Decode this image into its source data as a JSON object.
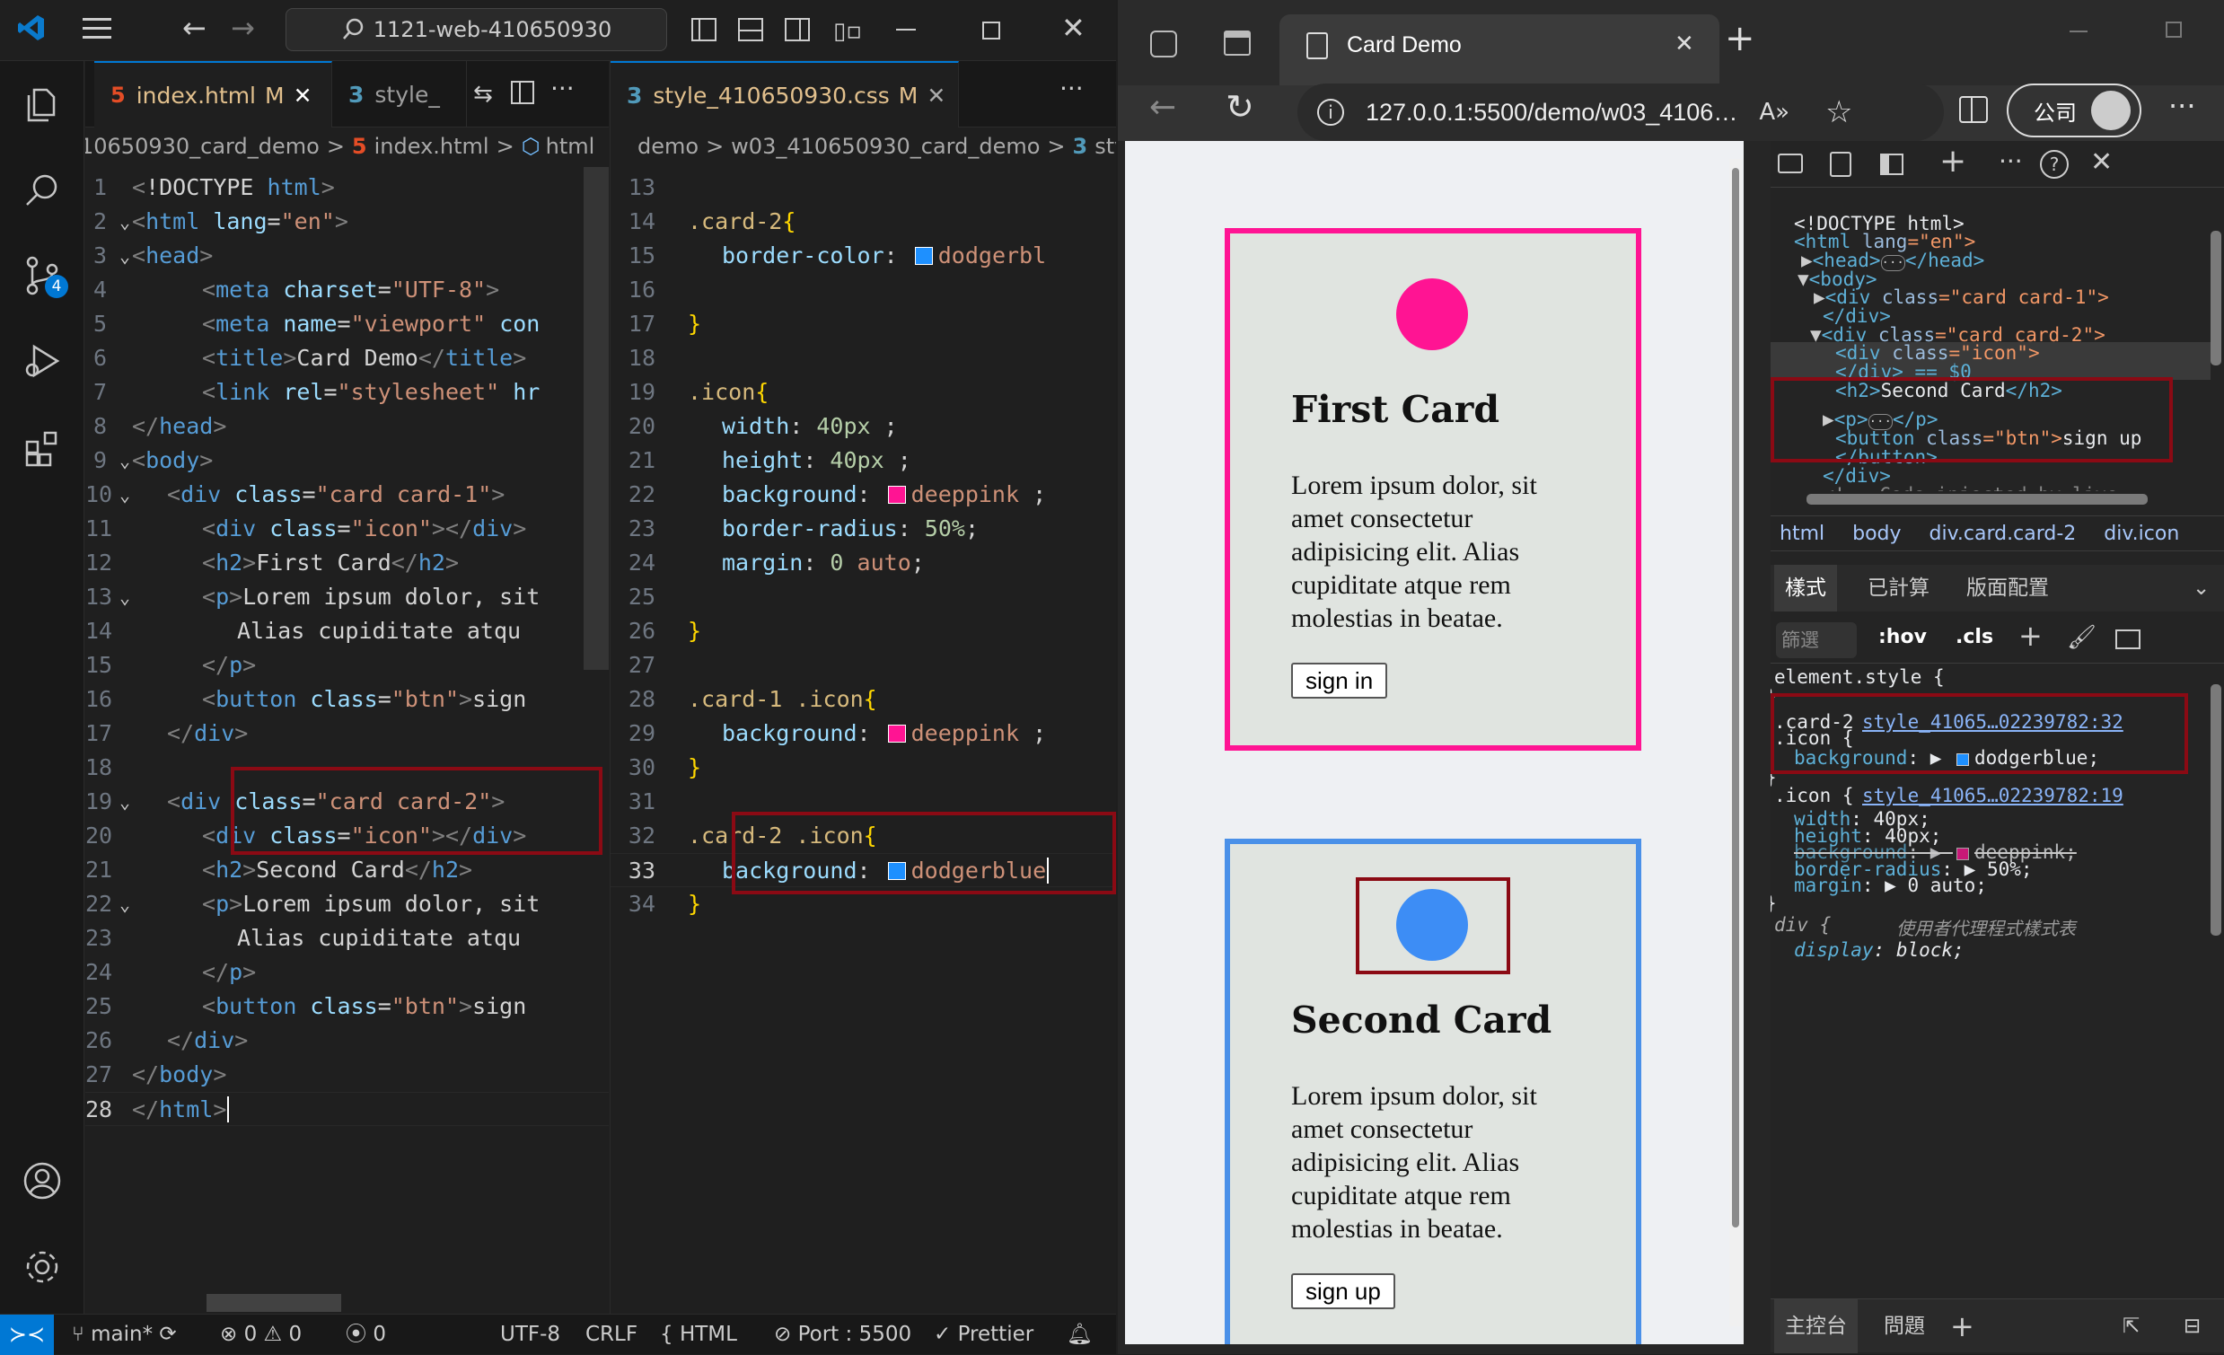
{
  "vscode": {
    "search_text": "1121-web-410650930",
    "activity_badge": "4",
    "left_tabs": [
      {
        "label": "index.html",
        "modified": "M"
      },
      {
        "label": "style_"
      }
    ],
    "right_tabs": [
      {
        "label": "style_410650930.css",
        "modified": "M"
      }
    ],
    "left_crumb": [
      "10650930_card_demo",
      ">",
      "index.html",
      ">",
      "html"
    ],
    "right_crumb": [
      "demo",
      ">",
      "w03_410650930_card_demo",
      ">",
      "sty"
    ],
    "html_lines": [
      {
        "n": "1",
        "tokens": [
          [
            "p",
            "<"
          ],
          [
            "w",
            "!DOCTYPE "
          ],
          [
            "t",
            "html"
          ],
          [
            "p",
            ">"
          ]
        ],
        "indent": 0
      },
      {
        "n": "2",
        "fold": true,
        "tokens": [
          [
            "p",
            "<"
          ],
          [
            "t",
            "html "
          ],
          [
            "a",
            "lang"
          ],
          [
            "w",
            "="
          ],
          [
            "s",
            "\"en\""
          ],
          [
            "p",
            ">"
          ]
        ],
        "indent": 0
      },
      {
        "n": "3",
        "fold": true,
        "tokens": [
          [
            "p",
            "<"
          ],
          [
            "t",
            "head"
          ],
          [
            "p",
            ">"
          ]
        ],
        "indent": 0
      },
      {
        "n": "4",
        "tokens": [
          [
            "p",
            "<"
          ],
          [
            "t",
            "meta "
          ],
          [
            "a",
            "charset"
          ],
          [
            "w",
            "="
          ],
          [
            "s",
            "\"UTF-8\""
          ],
          [
            "p",
            ">"
          ]
        ],
        "indent": 2
      },
      {
        "n": "5",
        "tokens": [
          [
            "p",
            "<"
          ],
          [
            "t",
            "meta "
          ],
          [
            "a",
            "name"
          ],
          [
            "w",
            "="
          ],
          [
            "s",
            "\"viewport\""
          ],
          [
            "w",
            " "
          ],
          [
            "a",
            "con"
          ]
        ],
        "indent": 2
      },
      {
        "n": "6",
        "tokens": [
          [
            "p",
            "<"
          ],
          [
            "t",
            "title"
          ],
          [
            "p",
            ">"
          ],
          [
            "w",
            "Card Demo"
          ],
          [
            "p",
            "</"
          ],
          [
            "t",
            "title"
          ],
          [
            "p",
            ">"
          ]
        ],
        "indent": 2
      },
      {
        "n": "7",
        "tokens": [
          [
            "p",
            "<"
          ],
          [
            "t",
            "link "
          ],
          [
            "a",
            "rel"
          ],
          [
            "w",
            "="
          ],
          [
            "s",
            "\"stylesheet\""
          ],
          [
            "w",
            " "
          ],
          [
            "a",
            "hr"
          ]
        ],
        "indent": 2
      },
      {
        "n": "8",
        "tokens": [
          [
            "p",
            "</"
          ],
          [
            "t",
            "head"
          ],
          [
            "p",
            ">"
          ]
        ],
        "indent": 0
      },
      {
        "n": "9",
        "fold": true,
        "tokens": [
          [
            "p",
            "<"
          ],
          [
            "t",
            "body"
          ],
          [
            "p",
            ">"
          ]
        ],
        "indent": 0
      },
      {
        "n": "10",
        "fold": true,
        "tokens": [
          [
            "p",
            "<"
          ],
          [
            "t",
            "div "
          ],
          [
            "a",
            "class"
          ],
          [
            "w",
            "="
          ],
          [
            "s",
            "\"card card-1\""
          ],
          [
            "p",
            ">"
          ]
        ],
        "indent": 1
      },
      {
        "n": "11",
        "tokens": [
          [
            "p",
            "<"
          ],
          [
            "t",
            "div "
          ],
          [
            "a",
            "class"
          ],
          [
            "w",
            "="
          ],
          [
            "s",
            "\"icon\""
          ],
          [
            "p",
            "></"
          ],
          [
            "t",
            "div"
          ],
          [
            "p",
            ">"
          ]
        ],
        "indent": 2
      },
      {
        "n": "12",
        "tokens": [
          [
            "p",
            "<"
          ],
          [
            "t",
            "h2"
          ],
          [
            "p",
            ">"
          ],
          [
            "w",
            "First Card"
          ],
          [
            "p",
            "</"
          ],
          [
            "t",
            "h2"
          ],
          [
            "p",
            ">"
          ]
        ],
        "indent": 2
      },
      {
        "n": "13",
        "fold": true,
        "tokens": [
          [
            "p",
            "<"
          ],
          [
            "t",
            "p"
          ],
          [
            "p",
            ">"
          ],
          [
            "w",
            "Lorem ipsum dolor, sit"
          ]
        ],
        "indent": 2
      },
      {
        "n": "14",
        "tokens": [
          [
            "w",
            "Alias cupiditate atqu"
          ]
        ],
        "indent": 3
      },
      {
        "n": "15",
        "tokens": [
          [
            "p",
            "</"
          ],
          [
            "t",
            "p"
          ],
          [
            "p",
            ">"
          ]
        ],
        "indent": 2
      },
      {
        "n": "16",
        "tokens": [
          [
            "p",
            "<"
          ],
          [
            "t",
            "button "
          ],
          [
            "a",
            "class"
          ],
          [
            "w",
            "="
          ],
          [
            "s",
            "\"btn\""
          ],
          [
            "p",
            ">"
          ],
          [
            "w",
            "sign"
          ]
        ],
        "indent": 2
      },
      {
        "n": "17",
        "tokens": [
          [
            "p",
            "</"
          ],
          [
            "t",
            "div"
          ],
          [
            "p",
            ">"
          ]
        ],
        "indent": 1
      },
      {
        "n": "18",
        "tokens": [],
        "indent": 0
      },
      {
        "n": "19",
        "fold": true,
        "tokens": [
          [
            "p",
            "<"
          ],
          [
            "t",
            "div "
          ],
          [
            "a",
            "class"
          ],
          [
            "w",
            "="
          ],
          [
            "s",
            "\"card card-2\""
          ],
          [
            "p",
            ">"
          ]
        ],
        "indent": 1
      },
      {
        "n": "20",
        "tokens": [
          [
            "p",
            "<"
          ],
          [
            "t",
            "div "
          ],
          [
            "a",
            "class"
          ],
          [
            "w",
            "="
          ],
          [
            "s",
            "\"icon\""
          ],
          [
            "p",
            "></"
          ],
          [
            "t",
            "div"
          ],
          [
            "p",
            ">"
          ]
        ],
        "indent": 2
      },
      {
        "n": "21",
        "tokens": [
          [
            "p",
            "<"
          ],
          [
            "t",
            "h2"
          ],
          [
            "p",
            ">"
          ],
          [
            "w",
            "Second Card"
          ],
          [
            "p",
            "</"
          ],
          [
            "t",
            "h2"
          ],
          [
            "p",
            ">"
          ]
        ],
        "indent": 2
      },
      {
        "n": "22",
        "fold": true,
        "tokens": [
          [
            "p",
            "<"
          ],
          [
            "t",
            "p"
          ],
          [
            "p",
            ">"
          ],
          [
            "w",
            "Lorem ipsum dolor, sit"
          ]
        ],
        "indent": 2
      },
      {
        "n": "23",
        "tokens": [
          [
            "w",
            "Alias cupiditate atqu"
          ]
        ],
        "indent": 3
      },
      {
        "n": "24",
        "tokens": [
          [
            "p",
            "</"
          ],
          [
            "t",
            "p"
          ],
          [
            "p",
            ">"
          ]
        ],
        "indent": 2
      },
      {
        "n": "25",
        "tokens": [
          [
            "p",
            "<"
          ],
          [
            "t",
            "button "
          ],
          [
            "a",
            "class"
          ],
          [
            "w",
            "="
          ],
          [
            "s",
            "\"btn\""
          ],
          [
            "p",
            ">"
          ],
          [
            "w",
            "sign"
          ]
        ],
        "indent": 2
      },
      {
        "n": "26",
        "tokens": [
          [
            "p",
            "</"
          ],
          [
            "t",
            "div"
          ],
          [
            "p",
            ">"
          ]
        ],
        "indent": 1
      },
      {
        "n": "27",
        "tokens": [
          [
            "p",
            "</"
          ],
          [
            "t",
            "body"
          ],
          [
            "p",
            ">"
          ]
        ],
        "indent": 0
      },
      {
        "n": "28",
        "cur": true,
        "tokens": [
          [
            "p",
            "</"
          ],
          [
            "t",
            "html"
          ],
          [
            "p",
            ">"
          ]
        ],
        "indent": 0
      }
    ],
    "css_lines": [
      {
        "n": "13",
        "tokens": []
      },
      {
        "n": "14",
        "tokens": [
          [
            "sel",
            ".card-2"
          ],
          [
            "br",
            "{"
          ]
        ]
      },
      {
        "n": "15",
        "in": true,
        "tokens": [
          [
            "prop",
            "border-color"
          ],
          [
            "w",
            ": "
          ],
          [
            "sw",
            "#1e90ff"
          ],
          [
            "s",
            "dodgerbl"
          ]
        ]
      },
      {
        "n": "16",
        "tokens": []
      },
      {
        "n": "17",
        "tokens": [
          [
            "br",
            "}"
          ]
        ]
      },
      {
        "n": "18",
        "tokens": []
      },
      {
        "n": "19",
        "tokens": [
          [
            "sel",
            ".icon"
          ],
          [
            "br",
            "{"
          ]
        ]
      },
      {
        "n": "20",
        "in": true,
        "tokens": [
          [
            "prop",
            "width"
          ],
          [
            "w",
            ": "
          ],
          [
            "num",
            "40px"
          ],
          [
            "w",
            " ;"
          ]
        ]
      },
      {
        "n": "21",
        "in": true,
        "tokens": [
          [
            "prop",
            "height"
          ],
          [
            "w",
            ": "
          ],
          [
            "num",
            "40px"
          ],
          [
            "w",
            " ;"
          ]
        ]
      },
      {
        "n": "22",
        "in": true,
        "tokens": [
          [
            "prop",
            "background"
          ],
          [
            "w",
            ": "
          ],
          [
            "sw",
            "#ff1493"
          ],
          [
            "s",
            "deeppink"
          ],
          [
            "w",
            " ;"
          ]
        ]
      },
      {
        "n": "23",
        "in": true,
        "tokens": [
          [
            "prop",
            "border-radius"
          ],
          [
            "w",
            ": "
          ],
          [
            "num",
            "50%"
          ],
          [
            "w",
            ";"
          ]
        ]
      },
      {
        "n": "24",
        "in": true,
        "tokens": [
          [
            "prop",
            "margin"
          ],
          [
            "w",
            ": "
          ],
          [
            "num",
            "0"
          ],
          [
            "w",
            " "
          ],
          [
            "s",
            "auto"
          ],
          [
            "w",
            ";"
          ]
        ]
      },
      {
        "n": "25",
        "tokens": []
      },
      {
        "n": "26",
        "tokens": [
          [
            "br",
            "}"
          ]
        ]
      },
      {
        "n": "27",
        "tokens": []
      },
      {
        "n": "28",
        "tokens": [
          [
            "sel",
            ".card-1 .icon"
          ],
          [
            "br",
            "{"
          ]
        ]
      },
      {
        "n": "29",
        "in": true,
        "tokens": [
          [
            "prop",
            "background"
          ],
          [
            "w",
            ": "
          ],
          [
            "sw",
            "#ff1493"
          ],
          [
            "s",
            "deeppink"
          ],
          [
            "w",
            " ;"
          ]
        ]
      },
      {
        "n": "30",
        "tokens": [
          [
            "br",
            "}"
          ]
        ]
      },
      {
        "n": "31",
        "tokens": []
      },
      {
        "n": "32",
        "tokens": [
          [
            "sel",
            ".card-2 .icon"
          ],
          [
            "br",
            "{"
          ]
        ]
      },
      {
        "n": "33",
        "cur": true,
        "in": true,
        "tokens": [
          [
            "prop",
            "background"
          ],
          [
            "w",
            ": "
          ],
          [
            "sw",
            "#1e90ff"
          ],
          [
            "s",
            "dodgerblue"
          ]
        ]
      },
      {
        "n": "34",
        "tokens": [
          [
            "br",
            "}"
          ]
        ]
      }
    ],
    "status": {
      "branch": "main*",
      "errors": "0",
      "warnings": "0",
      "ports": "0",
      "encoding": "UTF-8",
      "eol": "CRLF",
      "language": "HTML",
      "port": "Port : 5500",
      "formatter": "Prettier"
    }
  },
  "edge": {
    "tab_title": "Card Demo",
    "url": "127.0.0.1:5500/demo/w03_4106…",
    "profile": "公司",
    "cards": [
      {
        "title": "First Card",
        "text": "Lorem ipsum dolor, sit amet consectetur adipisicing elit. Alias cupiditate atque rem molestias in beatae.",
        "button": "sign in",
        "color": "#ff1493"
      },
      {
        "title": "Second Card",
        "text": "Lorem ipsum dolor, sit amet consectetur adipisicing elit. Alias cupiditate atque rem molestias in beatae.",
        "button": "sign up",
        "color": "#1e90ff"
      }
    ]
  },
  "devtools": {
    "dom": {
      "l1": "<!DOCTYPE html>",
      "l2a": "<html ",
      "l2b": "lang",
      "l2c": "=\"en\">",
      "l3": "<head>",
      "l3b": "</head>",
      "l4": "<body>",
      "l5a": "<div ",
      "l5b": "class",
      "l5c": "=\"card card-1\">",
      "l6": "</div>",
      "l7a": "<div ",
      "l7b": "class",
      "l7c": "=\"card card-2\">",
      "l8a": "<div ",
      "l8b": "class",
      "l8c": "=\"icon\">",
      "l9": "</div> == $0",
      "l10a": "<h2>",
      "l10b": "Second Card",
      "l10c": "</h2>",
      "l11a": "<p>",
      "l11b": "</p>",
      "l12a": "<button ",
      "l12b": "class",
      "l12c": "=\"btn\">",
      "l12d": "sign up",
      "l13": "</button>",
      "l14": "</div>",
      "l15": "<!-- Code injected by live-"
    },
    "breadcrumb": [
      "html",
      "body",
      "div.card.card-2",
      "div.icon"
    ],
    "tabs": [
      "樣式",
      "已計算",
      "版面配置"
    ],
    "filter_placeholder": "篩選",
    "hov": ":hov",
    "cls": ".cls",
    "rules": {
      "element": "element.style {",
      "close": "}",
      "r1_sel1": ".card-2",
      "r1_sel2": ".icon {",
      "r1_link": "style_41065…02239782:32",
      "r1_prop": "background",
      "r1_val": "dodgerblue;",
      "r2_sel": ".icon {",
      "r2_link": "style_41065…02239782:19",
      "r2_props": [
        [
          "width",
          "40px;"
        ],
        [
          "height",
          "40px;"
        ],
        [
          "background",
          "deeppink;"
        ],
        [
          "border-radius",
          "50%;"
        ],
        [
          "margin",
          "0 auto;"
        ]
      ],
      "r3_sel": "div {",
      "r3_src": "使用者代理程式樣式表",
      "r3_prop": "display",
      "r3_val": "block;"
    },
    "bottom_tabs": [
      "主控台",
      "問題"
    ]
  }
}
